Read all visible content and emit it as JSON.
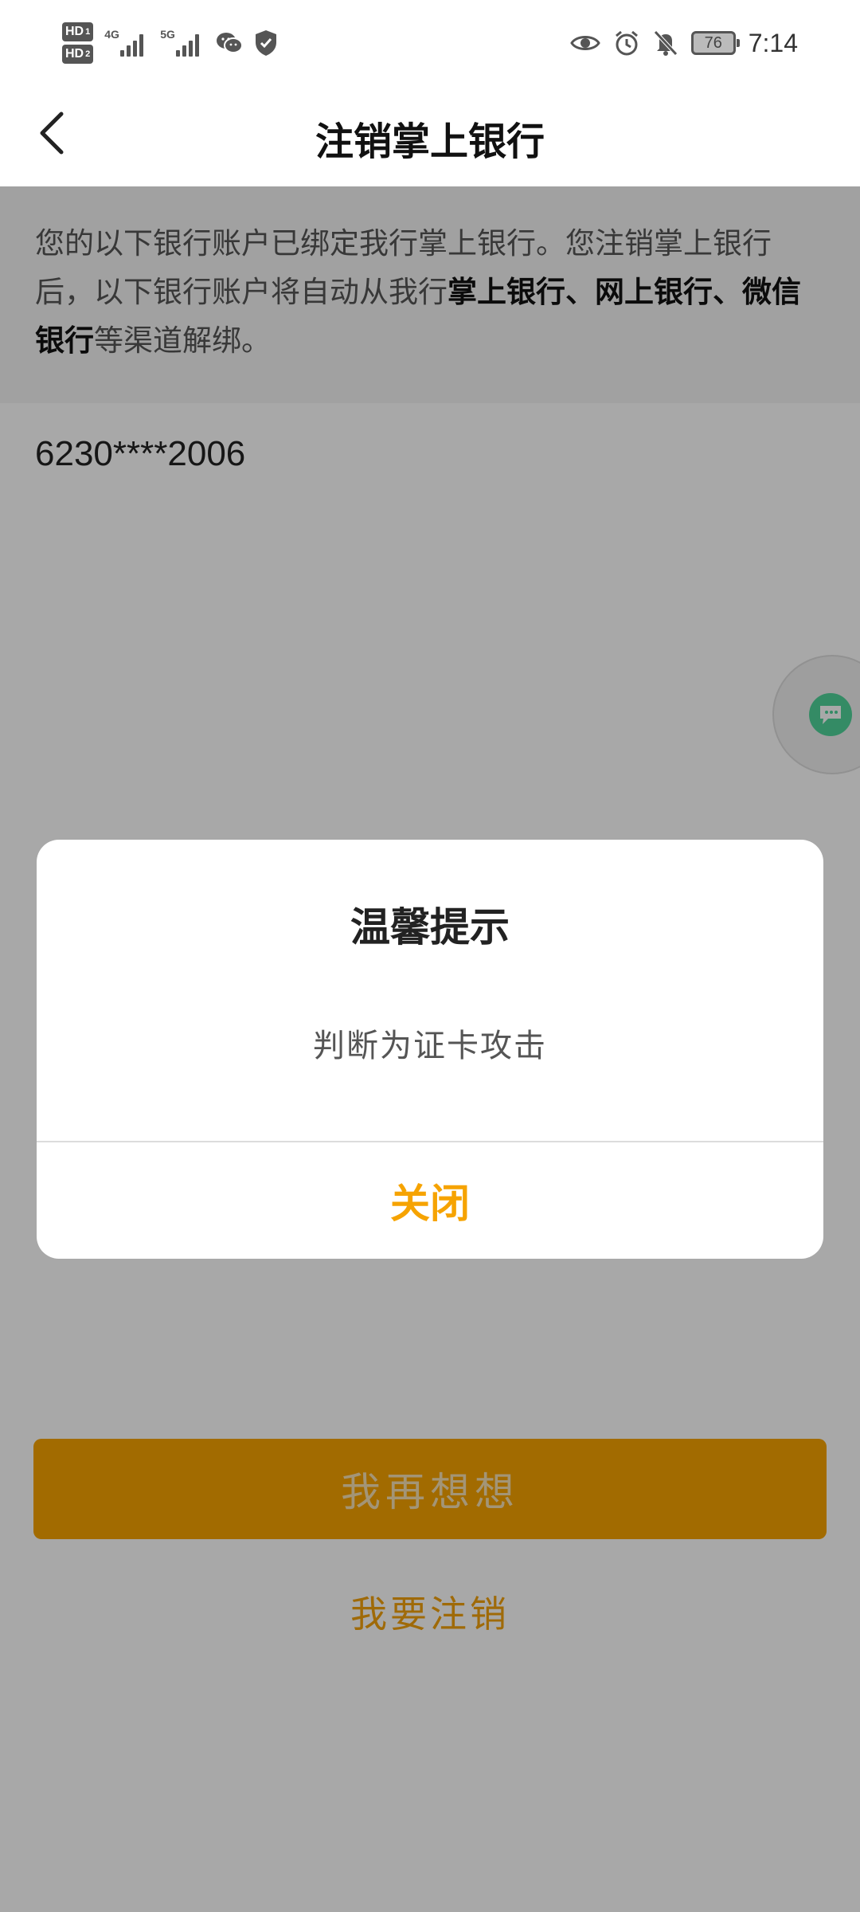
{
  "status_bar": {
    "hd1": "HD",
    "hd1_sub": "1",
    "hd2": "HD",
    "hd2_sub": "2",
    "net1": "4G",
    "net2": "5G",
    "battery": "76",
    "time": "7:14",
    "icons": [
      "wechat-icon",
      "shield-icon",
      "eye-icon",
      "alarm-icon",
      "bell-off-icon"
    ]
  },
  "app_bar": {
    "title": "注销掌上银行",
    "back_icon": "chevron-left-icon"
  },
  "notice": {
    "part1": "您的以下银行账户已绑定我行掌上银行。您注销掌上银行后，以下银行账户将自动从我行",
    "bold": "掌上银行、网上银行、微信银行",
    "part2": "等渠道解绑。"
  },
  "account": {
    "number": "6230****2006"
  },
  "buttons": {
    "reconsider": "我再想想",
    "cancel_account": "我要注销"
  },
  "dialog": {
    "title": "温馨提示",
    "message": "判断为证卡攻击",
    "close": "关闭"
  },
  "colors": {
    "accent": "#f6a300",
    "dialog_bg": "#ffffff",
    "overlay": "rgba(0,0,0,0.34)"
  }
}
